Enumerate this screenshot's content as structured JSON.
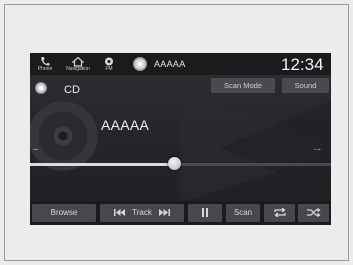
{
  "status_bar": {
    "phone_label": "Phone",
    "navigation_label": "Navigation",
    "fm_label": "FM",
    "source_title": "AAAAA",
    "clock": "12:34"
  },
  "header": {
    "source_name": "CD",
    "scan_mode_label": "Scan Mode",
    "sound_label": "Sound"
  },
  "now_playing": {
    "track_title": "AAAAA",
    "progress_fraction": 0.48
  },
  "controls": {
    "browse_label": "Browse",
    "track_label": "Track",
    "scan_label": "Scan"
  }
}
